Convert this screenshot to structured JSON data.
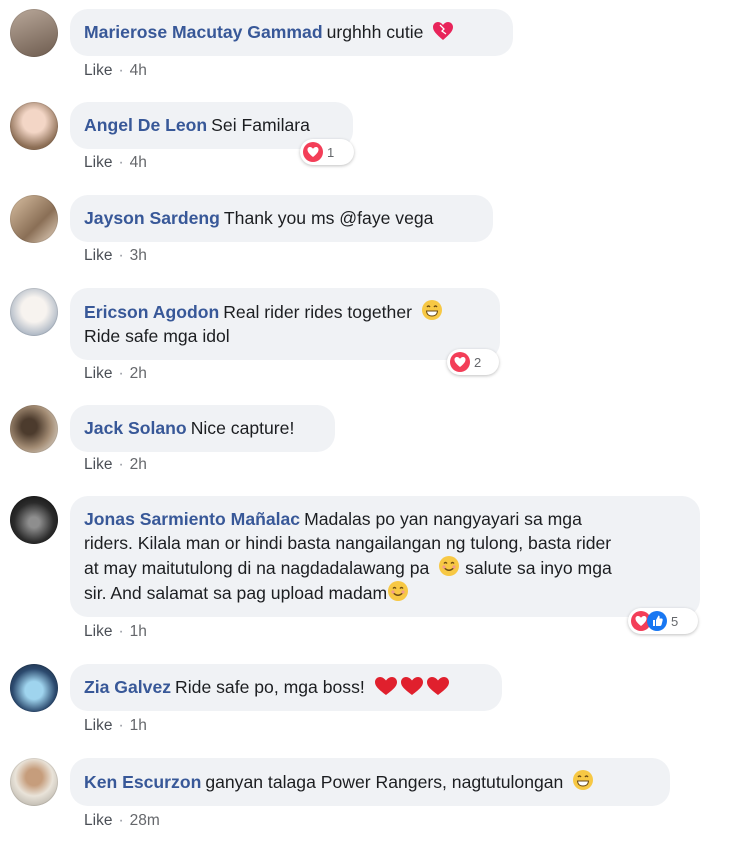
{
  "comments": [
    {
      "author": "Marierose Macutay Gammad",
      "text": "urghhh cutie",
      "like": "Like",
      "time": "4h"
    },
    {
      "author": "Angel De Leon",
      "text": "Sei Familara",
      "like": "Like",
      "time": "4h",
      "reaction_count": "1"
    },
    {
      "author": "Jayson Sardeng",
      "text": "Thank you ms @faye vega",
      "like": "Like",
      "time": "3h"
    },
    {
      "author": "Ericson Agodon",
      "text1": "Real rider rides together",
      "text2": "Ride safe mga idol",
      "like": "Like",
      "time": "2h",
      "reaction_count": "2"
    },
    {
      "author": "Jack Solano",
      "text": "Nice capture!",
      "like": "Like",
      "time": "2h"
    },
    {
      "author": "Jonas Sarmiento Mañalac",
      "line1": "Madalas po yan nangyayari sa mga",
      "line2": "riders. Kilala man or hindi basta nangailangan ng tulong, basta rider",
      "line3a": "at may maitutulong di na nagdadalawang pa",
      "line3b": "salute sa inyo mga",
      "line4": "sir. And salamat sa pag upload madam",
      "like": "Like",
      "time": "1h",
      "reaction_count": "5"
    },
    {
      "author": "Zia Galvez",
      "text": "Ride safe po, mga boss!",
      "like": "Like",
      "time": "1h"
    },
    {
      "author": "Ken Escurzon",
      "text": "ganyan talaga Power Rangers, nagtutulongan",
      "like": "Like",
      "time": "28m"
    }
  ],
  "colors": {
    "author": "#385898",
    "bubble": "#f0f2f5",
    "meta": "#65676b",
    "love": "#f33e58",
    "like": "#1877f2"
  },
  "icons": [
    "heart-emoji-icon",
    "grin-emoji-icon",
    "smile-emoji-icon",
    "love-reaction-icon",
    "like-reaction-icon"
  ]
}
